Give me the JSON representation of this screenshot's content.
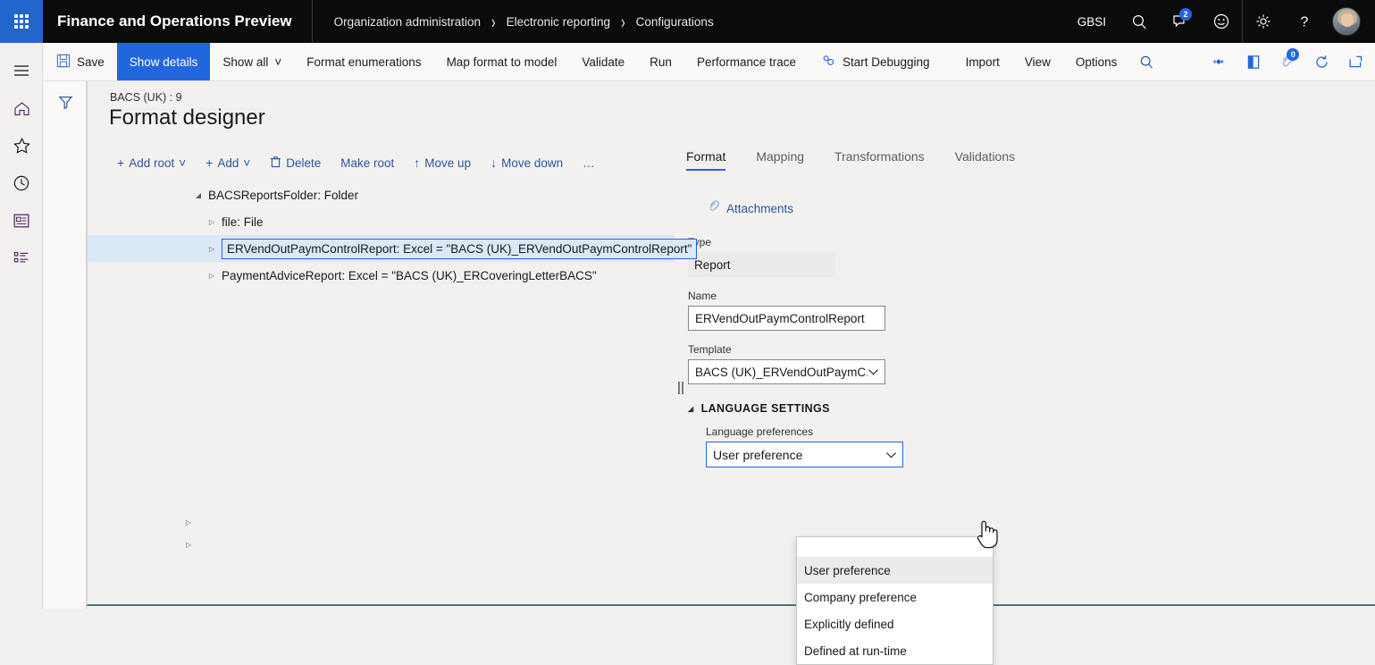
{
  "header": {
    "app_title": "Finance and Operations Preview",
    "waffle_icon": "app-launcher-icon",
    "breadcrumb": [
      {
        "label": "Organization administration"
      },
      {
        "label": "Electronic reporting"
      },
      {
        "label": "Configurations"
      }
    ],
    "breadcrumb_separator": "›",
    "company": "GBSI",
    "search_icon": "search-icon",
    "notifications_icon": "notifications-icon",
    "notifications_count": "2",
    "feedback_icon": "smiley-feedback-icon",
    "settings_icon": "gear-icon",
    "help_icon": "help-question-icon",
    "avatar": "user-avatar"
  },
  "nav_rail": [
    {
      "name": "hamburger-menu-icon",
      "label": "Expand the navigation pane"
    },
    {
      "name": "home-icon",
      "label": "Home"
    },
    {
      "name": "star-favorites-icon",
      "label": "Favorites"
    },
    {
      "name": "clock-recent-icon",
      "label": "Recent"
    },
    {
      "name": "workspaces-icon",
      "label": "Workspaces"
    },
    {
      "name": "modules-list-icon",
      "label": "Modules"
    }
  ],
  "filter_column": {
    "filter_icon": "filter-funnel-icon"
  },
  "command_bar": {
    "save": "Save",
    "save_icon": "save-disk-icon",
    "show_details": "Show details",
    "show_all": "Show all",
    "format_enumerations": "Format enumerations",
    "map_format_to_model": "Map format to model",
    "validate": "Validate",
    "run": "Run",
    "performance_trace": "Performance trace",
    "start_debugging": "Start Debugging",
    "start_debugging_icon": "gears-debug-icon",
    "import": "Import",
    "view": "View",
    "options": "Options",
    "chevron": "˅",
    "right_icons": [
      {
        "name": "search-icon"
      },
      {
        "name": "share-links-icon"
      },
      {
        "name": "page-options-icon"
      },
      {
        "name": "attachments-icon",
        "badge": "0"
      },
      {
        "name": "refresh-icon"
      },
      {
        "name": "open-in-new-window-icon"
      },
      {
        "name": "close-icon"
      }
    ]
  },
  "page": {
    "caption": "BACS (UK) : 9",
    "title": "Format designer"
  },
  "tree_toolbar": [
    {
      "label": "Add root",
      "icon": "plus-icon",
      "has_chevron": true
    },
    {
      "label": "Add",
      "icon": "plus-icon",
      "has_chevron": true
    },
    {
      "label": "Delete",
      "icon": "trash-icon",
      "has_chevron": false
    },
    {
      "label": "Make root",
      "icon": "",
      "has_chevron": false
    },
    {
      "label": "Move up",
      "icon": "arrow-up-icon",
      "has_chevron": false
    },
    {
      "label": "Move down",
      "icon": "arrow-down-icon",
      "has_chevron": false
    },
    {
      "label": "…",
      "icon": "",
      "has_chevron": false
    }
  ],
  "tree": {
    "nodes": [
      {
        "label": "BACSReportsFolder: Folder",
        "level": 0,
        "expanded": true,
        "selected": false
      },
      {
        "label": "file: File",
        "level": 1,
        "expanded": false,
        "selected": false
      },
      {
        "label": "ERVendOutPaymControlReport: Excel = \"BACS (UK)_ERVendOutPaymControlReport\"",
        "level": 1,
        "expanded": false,
        "selected": true
      },
      {
        "label": "PaymentAdviceReport: Excel = \"BACS (UK)_ERCoveringLetterBACS\"",
        "level": 1,
        "expanded": false,
        "selected": false
      }
    ],
    "expanded_glyph": "◢",
    "collapsed_glyph": "▷"
  },
  "detail": {
    "tabs": [
      {
        "label": "Format",
        "active": true
      },
      {
        "label": "Mapping",
        "active": false
      },
      {
        "label": "Transformations",
        "active": false
      },
      {
        "label": "Validations",
        "active": false
      }
    ],
    "attachments_label": "Attachments",
    "attachments_icon": "paperclip-icon",
    "type_label": "Type",
    "type_value": "Report",
    "name_label": "Name",
    "name_value": "ERVendOutPaymControlReport",
    "template_label": "Template",
    "template_value": "BACS (UK)_ERVendOutPaymC...",
    "language_section_title": "LANGUAGE SETTINGS",
    "language_pref_label": "Language preferences",
    "language_pref_value": "User preference",
    "language_options": [
      "User preference",
      "Company preference",
      "Explicitly defined",
      "Defined at run-time"
    ],
    "language_selected_index": 0
  },
  "colors": {
    "accent": "#2266dd",
    "header_bg": "#0b0b0b",
    "page_bg": "#f2f1f0",
    "selection_bg": "#dbe8f7",
    "link": "#2b579a"
  }
}
